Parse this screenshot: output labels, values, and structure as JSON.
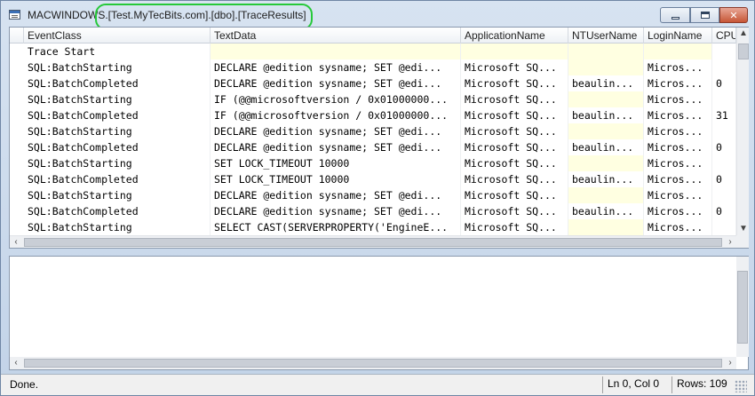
{
  "window": {
    "title": "MACWINDOWS.[Test.MyTecBits.com].[dbo].[TraceResults]",
    "highlight_color": "#26c93a"
  },
  "grid": {
    "columns": [
      "EventClass",
      "TextData",
      "ApplicationName",
      "NTUserName",
      "LoginName",
      "CPU"
    ],
    "rows": [
      {
        "event": "Trace Start",
        "text": "",
        "app": "",
        "user": "",
        "login": "",
        "cpu": ""
      },
      {
        "event": "SQL:BatchStarting",
        "text": "DECLARE @edition sysname;  SET @edi...",
        "app": "Microsoft SQ...",
        "user": "",
        "login": "Micros...",
        "cpu": ""
      },
      {
        "event": "SQL:BatchCompleted",
        "text": "DECLARE @edition sysname;  SET @edi...",
        "app": "Microsoft SQ...",
        "user": "beaulin...",
        "login": "Micros...",
        "cpu": "0"
      },
      {
        "event": "SQL:BatchStarting",
        "text": "IF (@@microsoftversion / 0x01000000...",
        "app": "Microsoft SQ...",
        "user": "",
        "login": "Micros...",
        "cpu": ""
      },
      {
        "event": "SQL:BatchCompleted",
        "text": "IF (@@microsoftversion / 0x01000000...",
        "app": "Microsoft SQ...",
        "user": "beaulin...",
        "login": "Micros...",
        "cpu": "31"
      },
      {
        "event": "SQL:BatchStarting",
        "text": "DECLARE @edition sysname;  SET @edi...",
        "app": "Microsoft SQ...",
        "user": "",
        "login": "Micros...",
        "cpu": ""
      },
      {
        "event": "SQL:BatchCompleted",
        "text": "DECLARE @edition sysname;  SET @edi...",
        "app": "Microsoft SQ...",
        "user": "beaulin...",
        "login": "Micros...",
        "cpu": "0"
      },
      {
        "event": "SQL:BatchStarting",
        "text": "SET LOCK_TIMEOUT 10000",
        "app": "Microsoft SQ...",
        "user": "",
        "login": "Micros...",
        "cpu": ""
      },
      {
        "event": "SQL:BatchCompleted",
        "text": "SET LOCK_TIMEOUT 10000",
        "app": "Microsoft SQ...",
        "user": "beaulin...",
        "login": "Micros...",
        "cpu": "0"
      },
      {
        "event": "SQL:BatchStarting",
        "text": "DECLARE @edition sysname;  SET @edi...",
        "app": "Microsoft SQ...",
        "user": "",
        "login": "Micros...",
        "cpu": ""
      },
      {
        "event": "SQL:BatchCompleted",
        "text": "DECLARE @edition sysname;  SET @edi...",
        "app": "Microsoft SQ...",
        "user": "beaulin...",
        "login": "Micros...",
        "cpu": "0"
      },
      {
        "event": "SQL:BatchStarting",
        "text": "SELECT CAST(SERVERPROPERTY('EngineE...",
        "app": "Microsoft SQ...",
        "user": "",
        "login": "Micros...",
        "cpu": ""
      }
    ]
  },
  "status": {
    "message": "Done.",
    "position": "Ln 0, Col 0",
    "rows": "Rows: 109"
  },
  "colors": {
    "empty_cell": "#ffffe1",
    "frame": "#c9d8ea",
    "close_button": "#c75636"
  }
}
